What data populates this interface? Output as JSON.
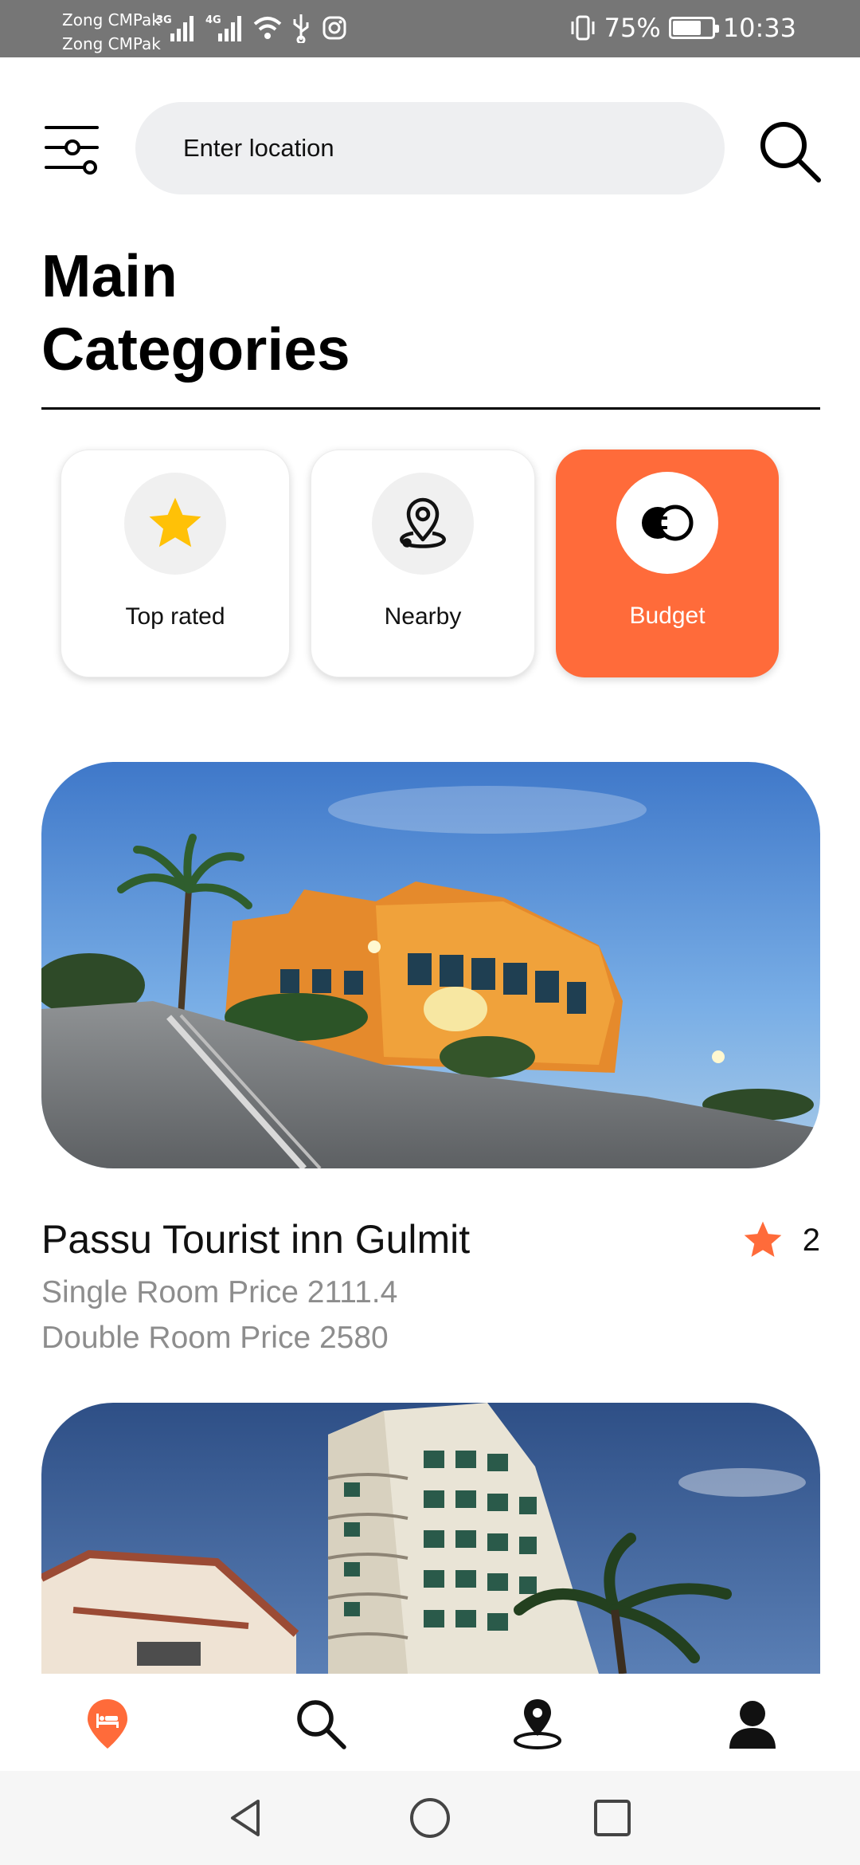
{
  "status_bar": {
    "carrier_1": "Zong CMPak",
    "carrier_2": "Zong CMPak",
    "network_1": "3G",
    "network_2": "4G",
    "battery_text": "75%",
    "battery_level": 0.75,
    "time": "10:33"
  },
  "header": {
    "location_placeholder": "Enter location",
    "filter_icon": "sliders-icon",
    "search_icon": "search-icon"
  },
  "section": {
    "title": "Main Categories"
  },
  "categories": [
    {
      "label": "Top rated",
      "icon": "star-icon",
      "active": false
    },
    {
      "label": "Nearby",
      "icon": "map-pin-icon",
      "active": false
    },
    {
      "label": "Budget",
      "icon": "coins-icon",
      "active": true
    }
  ],
  "listings": [
    {
      "name": "Passu Tourist inn Gulmit",
      "rating": "2",
      "single_room": "Single Room Price 2111.4",
      "double_room": "Double Room Price 2580"
    }
  ],
  "bottom_nav": [
    {
      "icon": "hotel-pin-icon",
      "active": true
    },
    {
      "icon": "search-icon",
      "active": false
    },
    {
      "icon": "map-location-icon",
      "active": false
    },
    {
      "icon": "profile-icon",
      "active": false
    }
  ],
  "colors": {
    "accent": "#ff6b3a",
    "star_yellow": "#ffc107",
    "status_bar": "#767676",
    "search_bg": "#eeeff1",
    "muted_text": "#8d8d8d"
  }
}
